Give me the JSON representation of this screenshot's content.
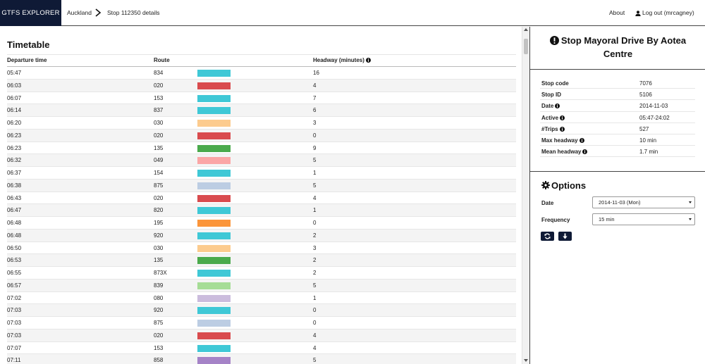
{
  "navbar": {
    "brand": "GTFS EXPLORER",
    "breadcrumb": [
      "Auckland",
      "Stop 112350 details"
    ],
    "about": "About",
    "logout": "Log out (mrcagney)"
  },
  "timetable": {
    "title": "Timetable",
    "columns": [
      "Departure time",
      "Route",
      "Headway (minutes)"
    ],
    "rows": [
      {
        "time": "05:47",
        "route": "834",
        "color": "#3fc8d6",
        "headway": "16"
      },
      {
        "time": "06:03",
        "route": "020",
        "color": "#d94b4e",
        "headway": "4"
      },
      {
        "time": "06:07",
        "route": "153",
        "color": "#3fc8d6",
        "headway": "7"
      },
      {
        "time": "06:14",
        "route": "837",
        "color": "#3fc8d6",
        "headway": "6"
      },
      {
        "time": "06:20",
        "route": "030",
        "color": "#fccb8e",
        "headway": "3"
      },
      {
        "time": "06:23",
        "route": "020",
        "color": "#d94b4e",
        "headway": "0"
      },
      {
        "time": "06:23",
        "route": "135",
        "color": "#4aaa4c",
        "headway": "9"
      },
      {
        "time": "06:32",
        "route": "049",
        "color": "#fba6a6",
        "headway": "5"
      },
      {
        "time": "06:37",
        "route": "154",
        "color": "#3fc8d6",
        "headway": "1"
      },
      {
        "time": "06:38",
        "route": "875",
        "color": "#bccde3",
        "headway": "5"
      },
      {
        "time": "06:43",
        "route": "020",
        "color": "#d94b4e",
        "headway": "4"
      },
      {
        "time": "06:47",
        "route": "820",
        "color": "#3fc8d6",
        "headway": "1"
      },
      {
        "time": "06:48",
        "route": "195",
        "color": "#fb953a",
        "headway": "0"
      },
      {
        "time": "06:48",
        "route": "920",
        "color": "#3fc8d6",
        "headway": "2"
      },
      {
        "time": "06:50",
        "route": "030",
        "color": "#fccb8e",
        "headway": "3"
      },
      {
        "time": "06:53",
        "route": "135",
        "color": "#4aaa4c",
        "headway": "2"
      },
      {
        "time": "06:55",
        "route": "873X",
        "color": "#3fc8d6",
        "headway": "2"
      },
      {
        "time": "06:57",
        "route": "839",
        "color": "#a6dd96",
        "headway": "5"
      },
      {
        "time": "07:02",
        "route": "080",
        "color": "#cbbcdd",
        "headway": "1"
      },
      {
        "time": "07:03",
        "route": "920",
        "color": "#3fc8d6",
        "headway": "0"
      },
      {
        "time": "07:03",
        "route": "875",
        "color": "#bccde3",
        "headway": "0"
      },
      {
        "time": "07:03",
        "route": "020",
        "color": "#d94b4e",
        "headway": "4"
      },
      {
        "time": "07:07",
        "route": "153",
        "color": "#3fc8d6",
        "headway": "4"
      },
      {
        "time": "07:11",
        "route": "858",
        "color": "#a583c7",
        "headway": "5"
      }
    ]
  },
  "stop": {
    "title": "Stop Mayoral Drive By Aotea Centre",
    "details": [
      {
        "key": "Stop code",
        "value": "7076",
        "info": false
      },
      {
        "key": "Stop ID",
        "value": "5106",
        "info": false
      },
      {
        "key": "Date",
        "value": "2014-11-03",
        "info": true
      },
      {
        "key": "Active",
        "value": "05:47-24:02",
        "info": true
      },
      {
        "key": "#Trips",
        "value": "527",
        "info": true
      },
      {
        "key": "Max headway",
        "value": "10 min",
        "info": true
      },
      {
        "key": "Mean headway",
        "value": "1.7 min",
        "info": true
      }
    ]
  },
  "options": {
    "title": "Options",
    "date_label": "Date",
    "date_value": "2014-11-03 (Mon)",
    "frequency_label": "Frequency",
    "frequency_value": "15 min",
    "refresh_icon": "refresh-icon",
    "download_icon": "download-icon"
  }
}
